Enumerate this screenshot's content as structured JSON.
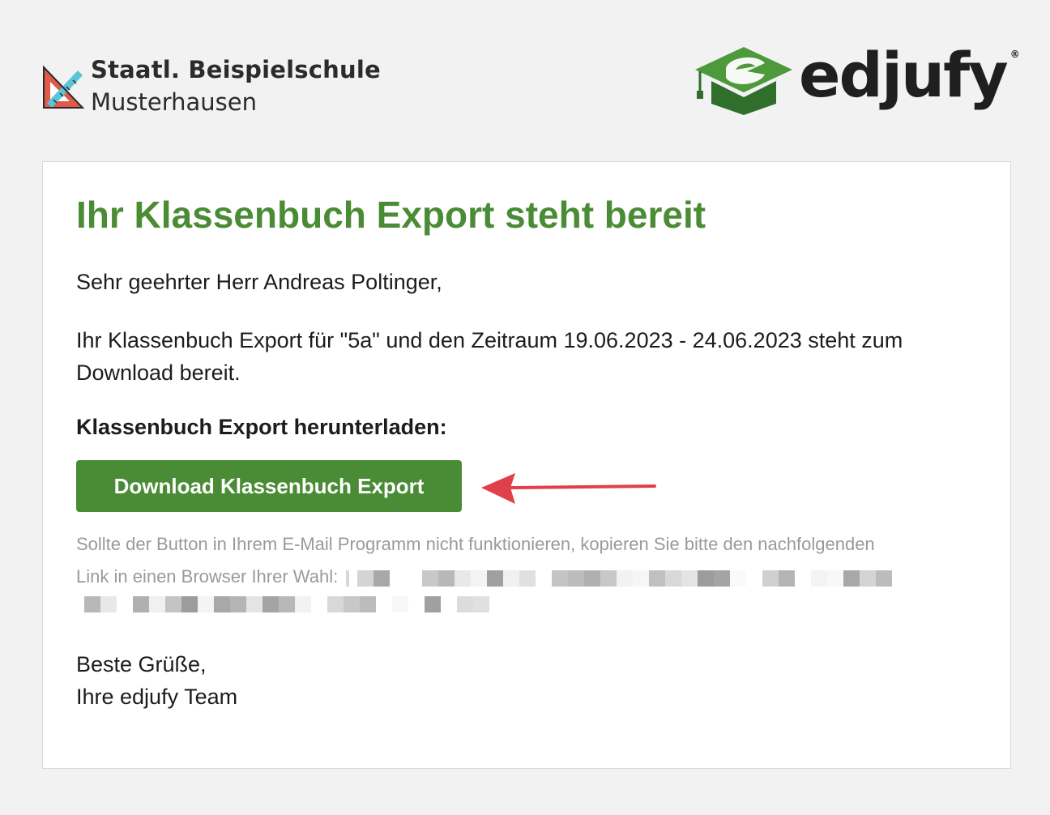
{
  "header": {
    "school": {
      "line1": "Staatl. Beispielschule",
      "line2": "Musterhausen",
      "icon": "set-square-ruler-icon"
    },
    "brand": {
      "name": "edjufy",
      "registered_mark": "®",
      "icon": "graduation-cap-e-icon",
      "color": "#3f8a36"
    }
  },
  "email": {
    "title": "Ihr Klassenbuch Export steht bereit",
    "greeting": "Sehr geehrter Herr Andreas Poltinger,",
    "body": "Ihr Klassenbuch Export für \"5a\" und den Zeitraum 19.06.2023 - 24.06.2023 steht zum Download bereit.",
    "download_heading": "Klassenbuch Export herunterladen:",
    "download_button": "Download Klassenbuch Export",
    "hint_line1": "Sollte der Button in Ihrem E-Mail Programm nicht funktionieren, kopieren Sie bitte den nachfolgenden",
    "hint_line2": "Link in einen Browser Ihrer Wahl:",
    "closing": "Beste Grüße,",
    "signature": "Ihre edjufy Team"
  },
  "colors": {
    "accent_green": "#4a8c35",
    "annotation_arrow": "#e0404a",
    "background": "#f2f2f2",
    "hint_text": "#9a9a9a"
  }
}
